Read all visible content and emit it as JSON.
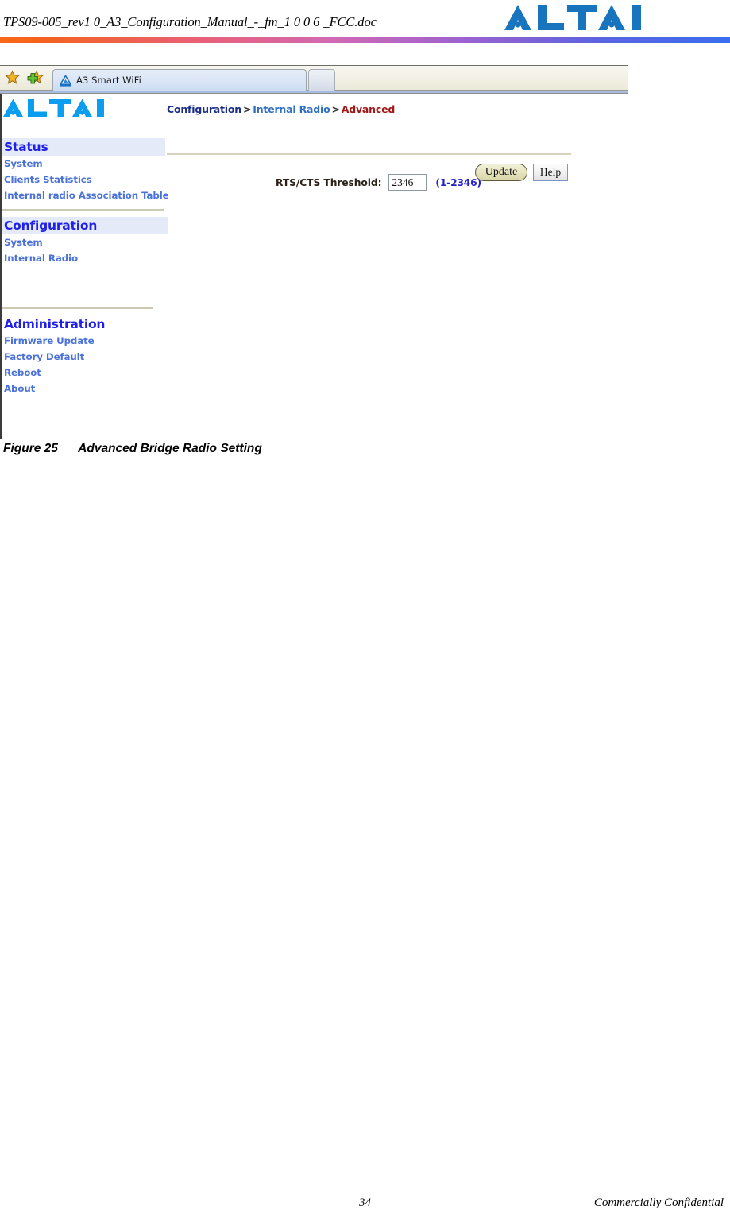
{
  "document": {
    "header_title": "TPS09-005_rev1 0_A3_Configuration_Manual_-_fm_1 0 0 6 _FCC.doc",
    "brand_logo": "altai-logo",
    "figure_caption": "Figure 25      Advanced Bridge Radio Setting",
    "footer_page_number": "34",
    "footer_confidentiality": "Commercially Confidential"
  },
  "browser": {
    "favorites_icon": "star-icon",
    "add_favorite_icon": "star-add-icon",
    "tab": {
      "favicon": "a3-triangle-favicon",
      "title": "A3 Smart WiFi"
    },
    "new_tab_label": ""
  },
  "app": {
    "logo": "altai-logo",
    "breadcrumb": {
      "level1": "Configuration",
      "separator": ">",
      "level2": "Internal Radio",
      "level3": "Advanced"
    },
    "buttons": {
      "update": "Update",
      "help": "Help"
    },
    "sidebar": {
      "sections": [
        {
          "heading": "Status",
          "items": [
            "System",
            "Clients Statistics",
            "Internal radio Association Table"
          ]
        },
        {
          "heading": "Configuration",
          "items": [
            "System",
            "Internal Radio"
          ]
        },
        {
          "heading": "Administration",
          "items": [
            "Firmware Update",
            "Factory Default",
            "Reboot",
            "About"
          ]
        }
      ]
    },
    "form": {
      "rts_cts_label": "RTS/CTS Threshold:",
      "rts_cts_value": "2346",
      "rts_cts_range": "(1-2346)"
    }
  },
  "colors": {
    "doc_logo_blue": "#1874bd",
    "app_logo_blue": "#0b9ef0",
    "nav_heading": "#2020e8",
    "nav_item": "#4a72d8",
    "crumb_level1": "#1c2f86",
    "crumb_level2": "#2f6fc2",
    "crumb_level3": "#a01818",
    "range_hint": "#2323c8",
    "nav_heading_bg": "#e4eaf8",
    "divider": "#cbc8b4"
  }
}
